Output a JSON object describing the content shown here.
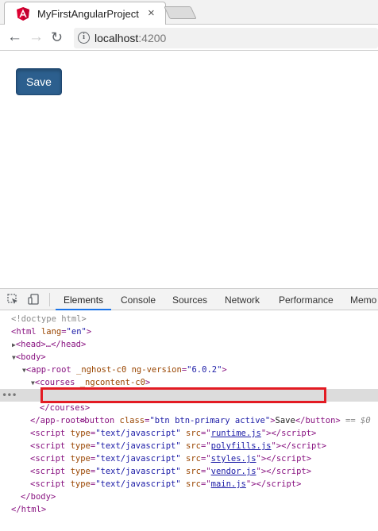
{
  "browser": {
    "tab_title": "MyFirstAngularProject",
    "tab_close": "×",
    "url_host": "localhost",
    "url_port": ":4200",
    "back_glyph": "←",
    "forward_glyph": "→",
    "reload_glyph": "↻",
    "info_glyph": "i"
  },
  "page": {
    "save_label": "Save",
    "button_color": "#2c5f8e"
  },
  "devtools": {
    "tabs": [
      "Elements",
      "Console",
      "Sources",
      "Network",
      "Performance",
      "Memo"
    ],
    "active_tab": "Elements",
    "selected_suffix": "== $0",
    "dots": "•••"
  },
  "dom_tree": {
    "doctype": "<!doctype html>",
    "html_open": "<html",
    "html_attr": " lang",
    "html_val": "\"en\"",
    "head": "<head>…</head>",
    "body_open": "<body>",
    "app_root_open": "<app-root",
    "app_root_attr1": " _nghost-c0",
    "app_root_attr2": " ng-version",
    "app_root_val2": "\"6.0.2\"",
    "courses_open": "<courses",
    "courses_attr": " _ngcontent-c0",
    "button_open": "<button",
    "button_attr": " class",
    "button_val": "\"btn btn-primary active\"",
    "button_text": "Save",
    "button_close": "</button>",
    "courses_close": "</courses>",
    "app_root_close": "</app-root>",
    "scripts": [
      "runtime.js",
      "polyfills.js",
      "styles.js",
      "vendor.js",
      "main.js"
    ],
    "script_type": "\"text/javascript\"",
    "body_close": "</body>",
    "html_close": "</html>"
  },
  "colors": {
    "tag": "#881280",
    "attr": "#994500",
    "value": "#1a1aa6",
    "highlight": "#e31b23"
  }
}
